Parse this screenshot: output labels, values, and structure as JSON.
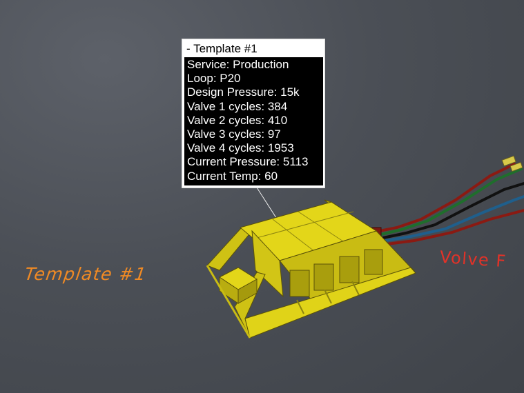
{
  "tooltip": {
    "title": "- Template #1",
    "lines": [
      "Service: Production",
      "Loop: P20",
      "Design Pressure: 15k",
      "Valve 1 cycles: 384",
      "Valve 2 cycles: 410",
      "Valve 3 cycles: 97",
      "Valve 4 cycles: 1953",
      "Current Pressure: 5113",
      "Current Temp: 60"
    ]
  },
  "labels": {
    "template": "Template #1",
    "valve": "Volve F"
  },
  "colors": {
    "structure": "#e3d619",
    "template_label": "#f08a24",
    "valve_label": "#e23228",
    "pipes": [
      "#8b1a12",
      "#1f6e2c",
      "#111111",
      "#1f5f8c",
      "#8b1a12"
    ]
  }
}
